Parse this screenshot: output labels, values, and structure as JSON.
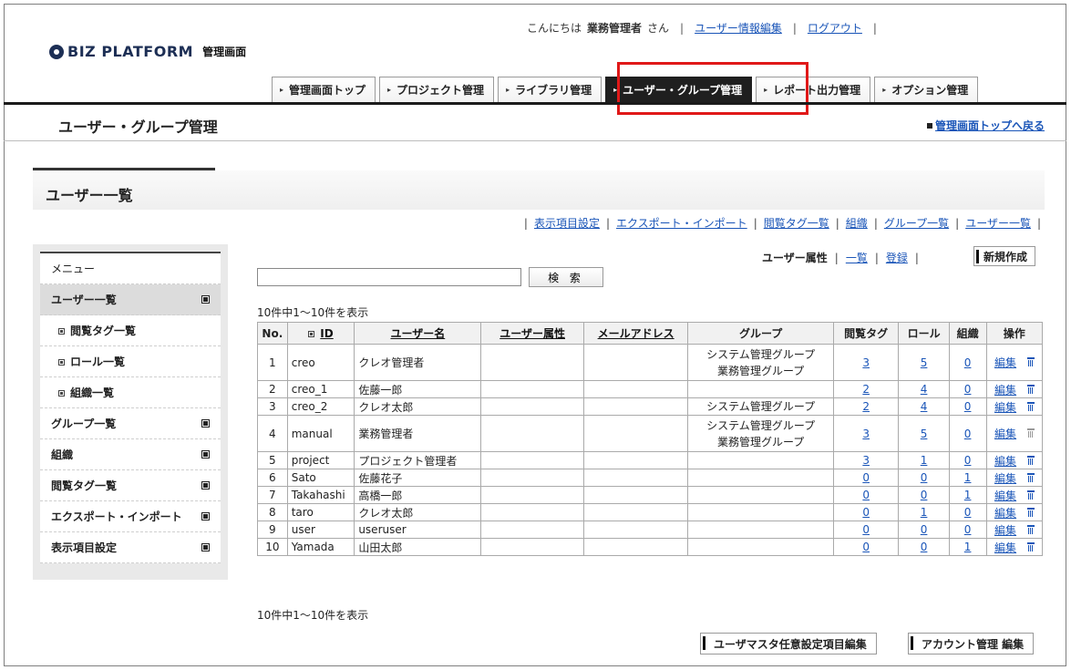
{
  "header": {
    "logo_text": "BIZ PLATFORM",
    "logo_sub": "管理画面",
    "greeting": "こんにちは",
    "user_name": "業務管理者",
    "honorific": "さん",
    "user_edit_link": "ユーザー情報編集",
    "logout_link": "ログアウト"
  },
  "global_nav": [
    {
      "label": "管理画面トップ",
      "active": false
    },
    {
      "label": "プロジェクト管理",
      "active": false
    },
    {
      "label": "ライブラリ管理",
      "active": false
    },
    {
      "label": "ユーザー・グループ管理",
      "active": true
    },
    {
      "label": "レポート出力管理",
      "active": false
    },
    {
      "label": "オプション管理",
      "active": false
    }
  ],
  "page": {
    "title": "ユーザー・グループ管理",
    "back_link": "管理画面トップへ戻る",
    "section_title": "ユーザー一覧"
  },
  "sub_links": [
    "表示項目設定",
    "エクスポート・インポート",
    "閲覧タグ一覧",
    "組織",
    "グループ一覧",
    "ユーザー一覧"
  ],
  "sidebar": {
    "header": "メニュー",
    "items": [
      {
        "label": "ユーザー一覧",
        "selected": true,
        "sub": false
      },
      {
        "label": "閲覧タグ一覧",
        "selected": false,
        "sub": true
      },
      {
        "label": "ロール一覧",
        "selected": false,
        "sub": true
      },
      {
        "label": "組織一覧",
        "selected": false,
        "sub": true
      },
      {
        "label": "グループ一覧",
        "selected": false,
        "sub": false
      },
      {
        "label": "組織",
        "selected": false,
        "sub": false
      },
      {
        "label": "閲覧タグ一覧",
        "selected": false,
        "sub": false
      },
      {
        "label": "エクスポート・インポート",
        "selected": false,
        "sub": false
      },
      {
        "label": "表示項目設定",
        "selected": false,
        "sub": false
      }
    ]
  },
  "user_attr": {
    "label": "ユーザー属性",
    "list_link": "一覧",
    "register_link": "登録",
    "new_button": "新規作成"
  },
  "search": {
    "value": "",
    "button": "検 索"
  },
  "count_text": "10件中1～10件を表示",
  "table": {
    "columns": [
      "No.",
      "ID",
      "ユーザー名",
      "ユーザー属性",
      "メールアドレス",
      "グループ",
      "閲覧タグ",
      "ロール",
      "組織",
      "操作"
    ],
    "edit_label": "編集",
    "rows": [
      {
        "no": "1",
        "id": "creo",
        "name": "クレオ管理者",
        "attr": "",
        "mail": "",
        "groups": [
          "システム管理グループ",
          "業務管理グループ"
        ],
        "tag": "3",
        "role": "5",
        "org": "0",
        "trash_enabled": true
      },
      {
        "no": "2",
        "id": "creo_1",
        "name": "佐藤一郎",
        "attr": "",
        "mail": "",
        "groups": [],
        "tag": "2",
        "role": "4",
        "org": "0",
        "trash_enabled": true
      },
      {
        "no": "3",
        "id": "creo_2",
        "name": "クレオ太郎",
        "attr": "",
        "mail": "",
        "groups": [
          "システム管理グループ"
        ],
        "tag": "2",
        "role": "4",
        "org": "0",
        "trash_enabled": true
      },
      {
        "no": "4",
        "id": "manual",
        "name": "業務管理者",
        "attr": "",
        "mail": "",
        "groups": [
          "システム管理グループ",
          "業務管理グループ"
        ],
        "tag": "3",
        "role": "5",
        "org": "0",
        "trash_enabled": false
      },
      {
        "no": "5",
        "id": "project",
        "name": "プロジェクト管理者",
        "attr": "",
        "mail": "",
        "groups": [],
        "tag": "3",
        "role": "1",
        "org": "0",
        "trash_enabled": true
      },
      {
        "no": "6",
        "id": "Sato",
        "name": "佐藤花子",
        "attr": "",
        "mail": "",
        "groups": [],
        "tag": "0",
        "role": "0",
        "org": "1",
        "trash_enabled": true
      },
      {
        "no": "7",
        "id": "Takahashi",
        "name": "高橋一郎",
        "attr": "",
        "mail": "",
        "groups": [],
        "tag": "0",
        "role": "0",
        "org": "1",
        "trash_enabled": true
      },
      {
        "no": "8",
        "id": "taro",
        "name": "クレオ太郎",
        "attr": "",
        "mail": "",
        "groups": [],
        "tag": "0",
        "role": "1",
        "org": "0",
        "trash_enabled": true
      },
      {
        "no": "9",
        "id": "user",
        "name": "useruser",
        "attr": "",
        "mail": "",
        "groups": [],
        "tag": "0",
        "role": "0",
        "org": "0",
        "trash_enabled": true
      },
      {
        "no": "10",
        "id": "Yamada",
        "name": "山田太郎",
        "attr": "",
        "mail": "",
        "groups": [],
        "tag": "0",
        "role": "0",
        "org": "1",
        "trash_enabled": true
      }
    ]
  },
  "footer_buttons": {
    "master_edit": "ユーザマスタ任意設定項目編集",
    "account_edit": "アカウント管理 編集"
  },
  "colors": {
    "highlight": "#e01818",
    "link": "#1a55b8"
  }
}
